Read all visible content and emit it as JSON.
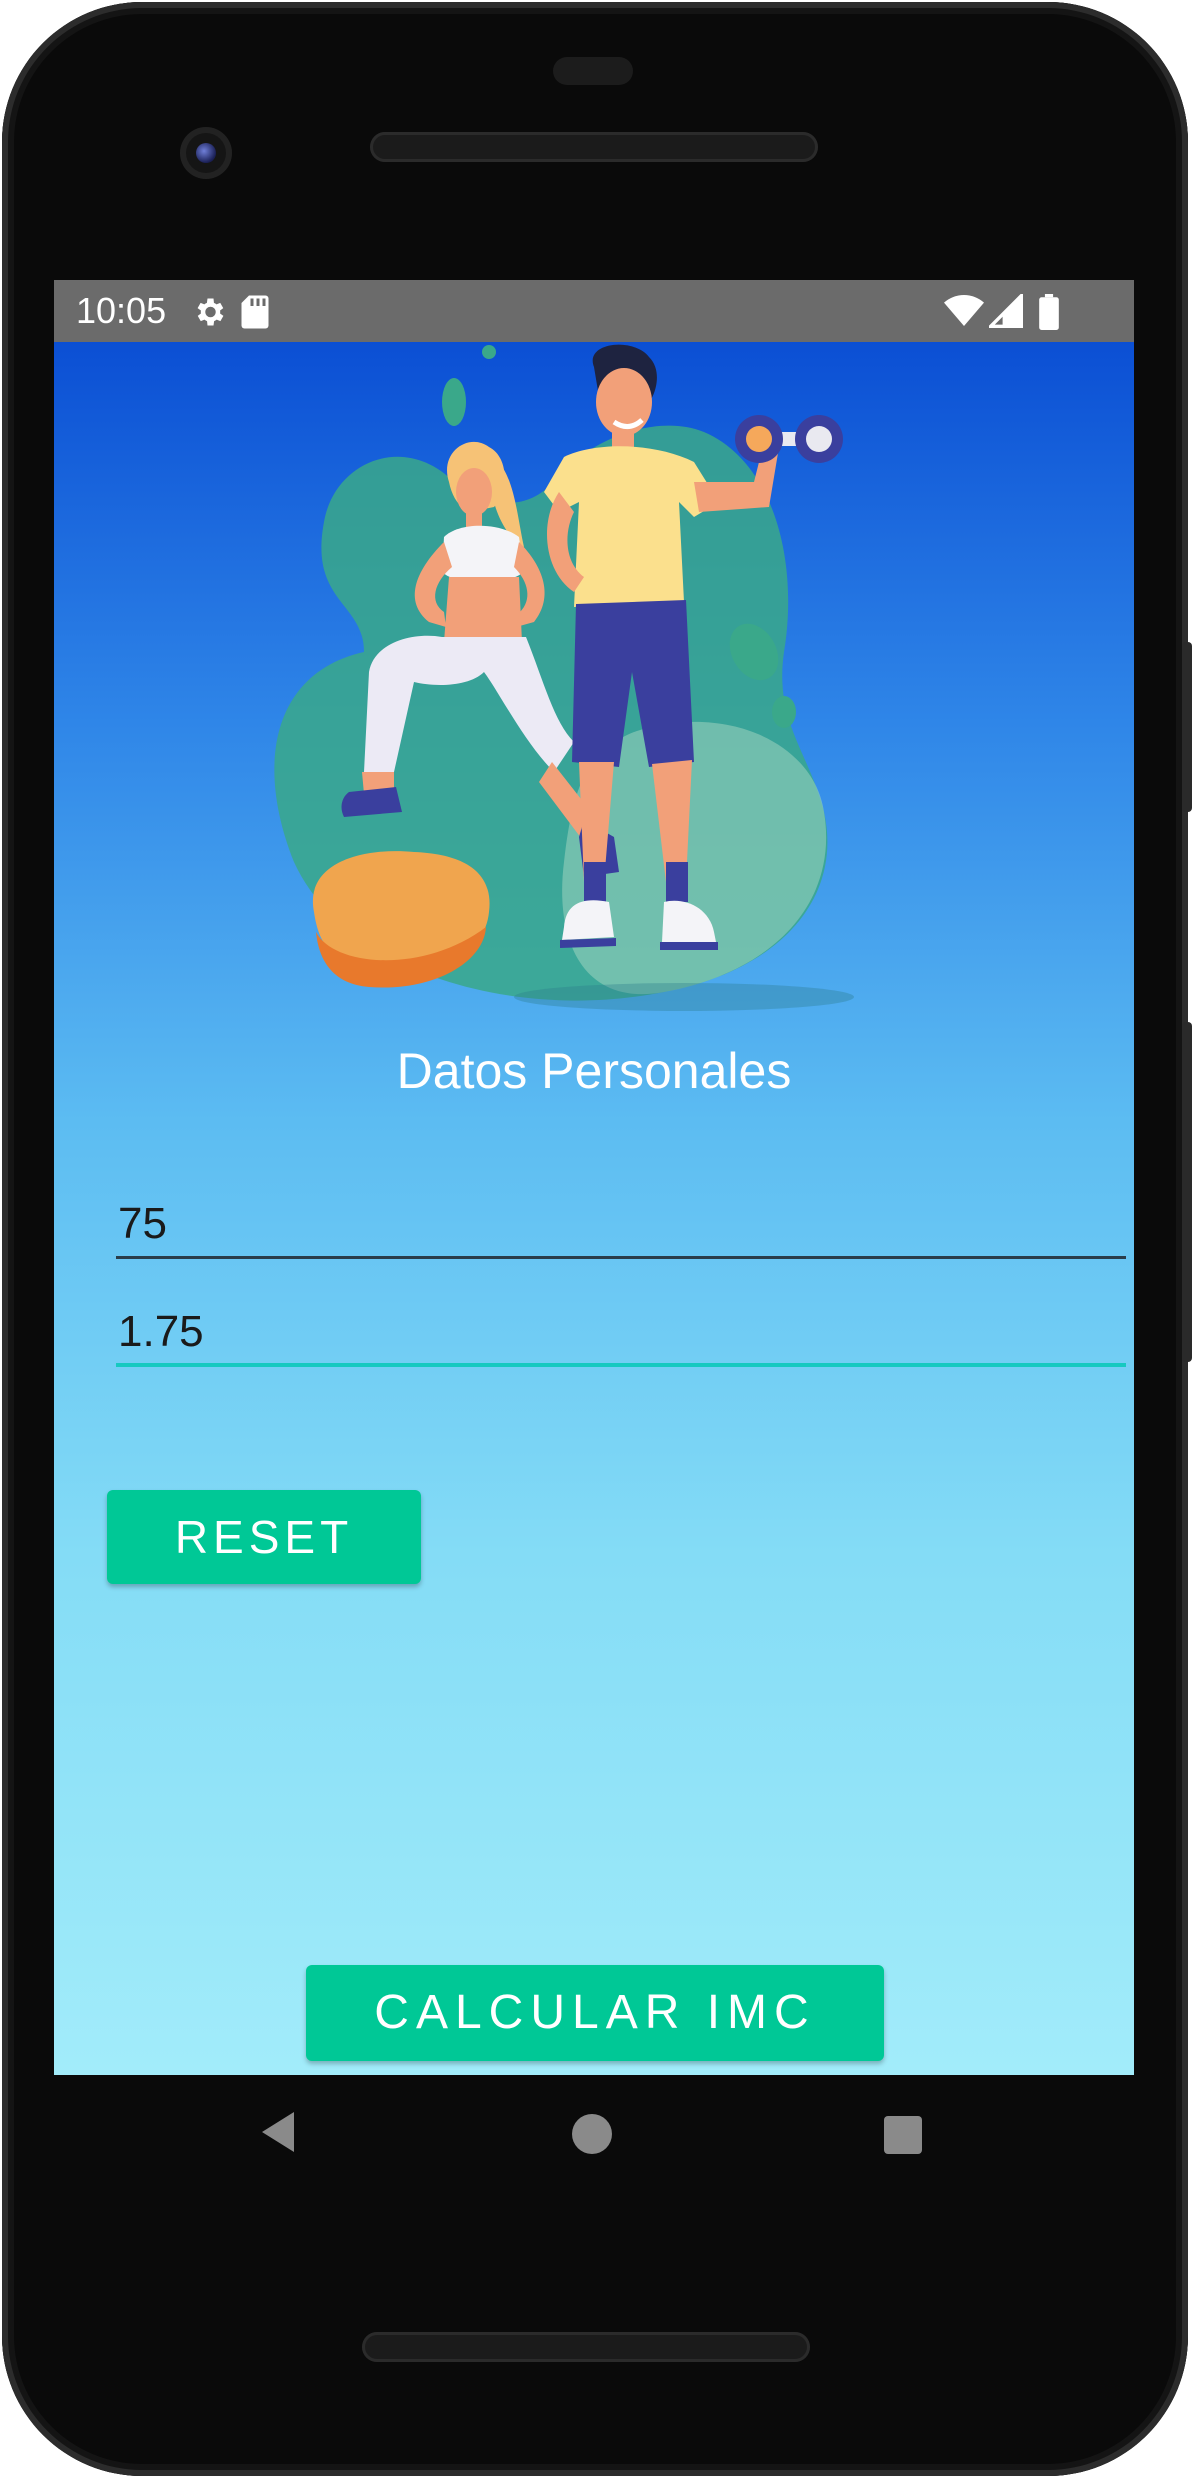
{
  "status_bar": {
    "time": "10:05"
  },
  "screen": {
    "heading": "Datos Personales",
    "weight_input": {
      "value": "75"
    },
    "height_input": {
      "value": "1.75"
    },
    "reset_label": "RESET",
    "calculate_label": "CALCULAR IMC"
  },
  "colors": {
    "accent_button": "#00c896",
    "active_underline": "#16c9c0",
    "gradient_top": "#0b4fd4",
    "gradient_bottom": "#a2ecfa"
  },
  "icons": [
    "settings-icon",
    "sd-card-icon",
    "wifi-icon",
    "cell-signal-icon",
    "battery-icon",
    "nav-back-icon",
    "nav-home-icon",
    "nav-recents-icon"
  ]
}
